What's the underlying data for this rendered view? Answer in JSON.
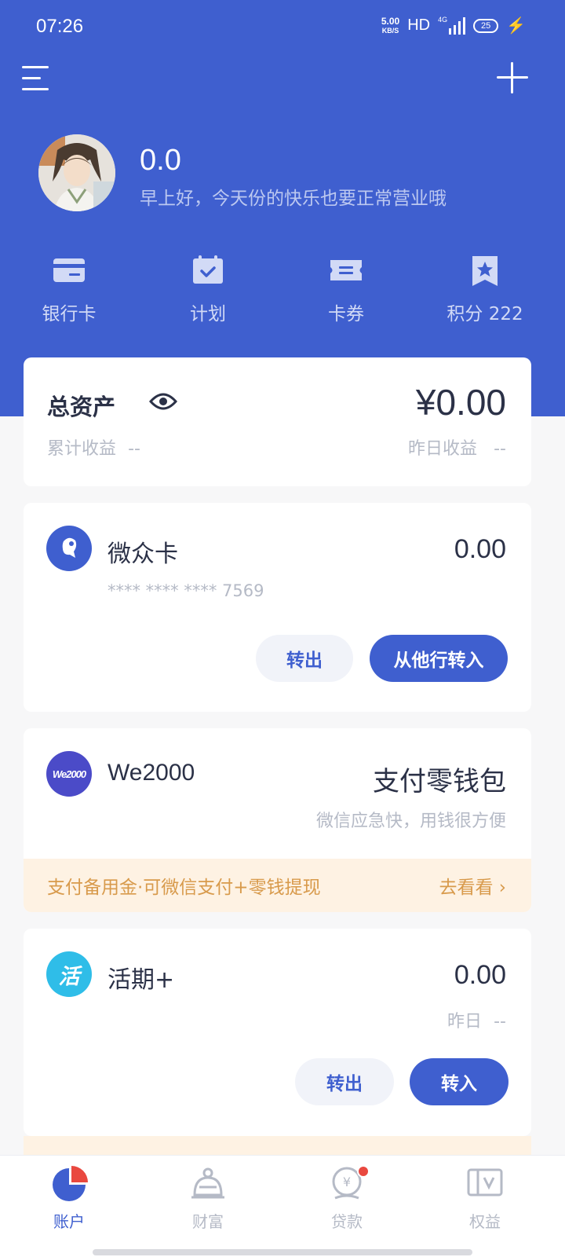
{
  "status": {
    "time": "07:26",
    "net_speed": "5.00",
    "net_unit": "KB/S",
    "hd": "HD",
    "network": "4G",
    "battery": "25"
  },
  "profile": {
    "name": "0.0",
    "greeting": "早上好，今天份的快乐也要正常营业哦"
  },
  "quick_actions": [
    {
      "label": "银行卡",
      "icon": "bank-card-icon"
    },
    {
      "label": "计划",
      "icon": "calendar-plan-icon"
    },
    {
      "label": "卡券",
      "icon": "coupon-icon"
    },
    {
      "label": "积分 222",
      "icon": "points-bookmark-icon"
    }
  ],
  "assets": {
    "title": "总资产",
    "amount": "¥0.00",
    "cumulative_label": "累计收益",
    "cumulative_value": "--",
    "yesterday_label": "昨日收益",
    "yesterday_value": "--"
  },
  "weizhong_card": {
    "name": "微众卡",
    "amount": "0.00",
    "card_number": "**** **** **** 7569",
    "btn_out": "转出",
    "btn_in": "从他行转入"
  },
  "we2000": {
    "logo_text": "We2000",
    "name": "We2000",
    "headline": "支付零钱包",
    "subtitle": "微信应急快，用钱很方便",
    "promo_text": "支付备用金·可微信支付+零钱提现",
    "promo_link": "去看看"
  },
  "huoqi": {
    "logo_text": "活",
    "name": "活期+",
    "amount": "0.00",
    "yesterday_label": "昨日",
    "yesterday_value": "--",
    "btn_out": "转出",
    "btn_in": "转入"
  },
  "tabs": [
    {
      "label": "账户",
      "active": true
    },
    {
      "label": "财富",
      "active": false
    },
    {
      "label": "贷款",
      "active": false
    },
    {
      "label": "权益",
      "active": false
    }
  ],
  "colors": {
    "primary": "#3f5fcf",
    "promo_bg": "#fef2e3",
    "promo_text": "#d89a4b",
    "red_dot": "#e9483f"
  }
}
